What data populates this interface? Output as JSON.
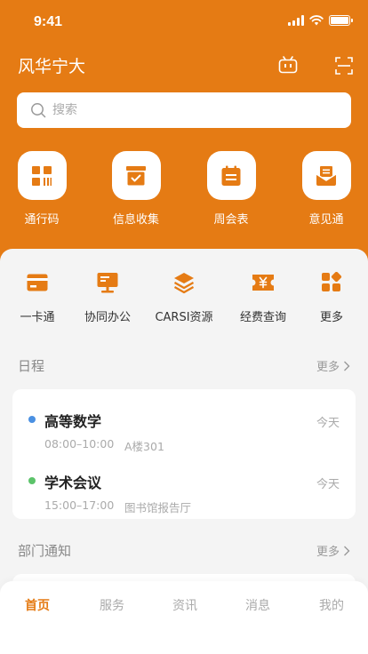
{
  "status_bar": {
    "time": "9:41"
  },
  "header": {
    "title": "风华宁大",
    "icons": [
      "robot-icon",
      "scan-icon"
    ]
  },
  "search": {
    "placeholder": "搜索"
  },
  "quick_actions": [
    {
      "label": "通行码",
      "icon": "pass-code-icon"
    },
    {
      "label": "信息收集",
      "icon": "collect-box-icon"
    },
    {
      "label": "周会表",
      "icon": "calendar-icon"
    },
    {
      "label": "意见通",
      "icon": "feedback-mail-icon"
    }
  ],
  "services": [
    {
      "label": "一卡通",
      "icon": "card-icon"
    },
    {
      "label": "协同办公",
      "icon": "monitor-icon"
    },
    {
      "label": "CARSI资源",
      "icon": "layers-icon"
    },
    {
      "label": "经费查询",
      "icon": "ticket-yuan-icon"
    },
    {
      "label": "更多",
      "icon": "grid-more-icon"
    }
  ],
  "schedule": {
    "title": "日程",
    "more": "更多",
    "events": [
      {
        "name": "高等数学",
        "day": "今天",
        "time": "08:00–10:00",
        "place": "A楼301",
        "dot_color": "#4a90e2"
      },
      {
        "name": "学术会议",
        "day": "今天",
        "time": "15:00–17:00",
        "place": "图书馆报告厅",
        "dot_color": "#5cc36a"
      }
    ]
  },
  "notices": {
    "title": "部门通知",
    "more": "更多"
  },
  "tabbar": {
    "tabs": [
      {
        "label": "首页",
        "active": true
      },
      {
        "label": "服务",
        "active": false
      },
      {
        "label": "资讯",
        "active": false
      },
      {
        "label": "消息",
        "active": false
      },
      {
        "label": "我的",
        "active": false
      }
    ]
  },
  "colors": {
    "brand": "#e57b14",
    "background": "#f4f4f4",
    "card": "#ffffff"
  }
}
